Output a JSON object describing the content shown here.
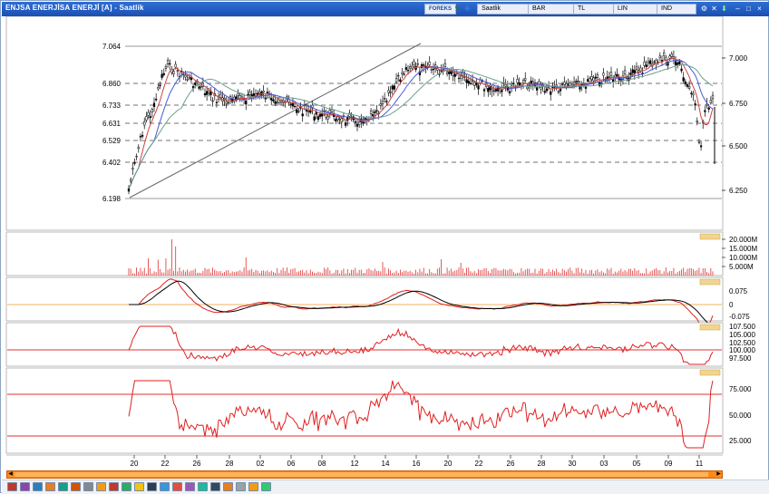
{
  "window": {
    "title": "ENJSA ENERJİSA ENERJİ [A] - Saatlik",
    "toolbar": [
      "Saatlik",
      "BAR",
      "TL",
      "LIN",
      "IND"
    ],
    "brand_badge": "FOREKS"
  },
  "price_panel": {
    "fib_levels": [
      "7.064",
      "6.860",
      "6.733",
      "6.631",
      "6.529",
      "6.402",
      "6.198"
    ],
    "axis_ticks": [
      "7.000",
      "6.750",
      "6.500",
      "6.250"
    ]
  },
  "volume_panel": {
    "axis_ticks": [
      "20.000M",
      "15.000M",
      "10.000M",
      "5.000M"
    ]
  },
  "macd_panel": {
    "axis_ticks": [
      "0.075",
      "0",
      "-0.075"
    ]
  },
  "momentum_panel": {
    "axis_ticks": [
      "107.500",
      "105.000",
      "102.500",
      "100.000",
      "97.500"
    ]
  },
  "rsi_panel": {
    "axis_ticks": [
      "75.000",
      "50.000",
      "25.000"
    ]
  },
  "x_axis": {
    "labels": [
      "20",
      "22",
      "26",
      "28",
      "02",
      "06",
      "08",
      "12",
      "14",
      "16",
      "20",
      "22",
      "26",
      "28",
      "30",
      "03",
      "05",
      "09",
      "11"
    ]
  },
  "colors": {
    "titlebar": "#1f5cc4",
    "scroll": "#ff8a1a",
    "signal": "#e02020",
    "ma_blue": "#4a5bd6",
    "ma_teal": "#6aa08a",
    "guide": "#e03030"
  },
  "icons": [
    "window-min-icon",
    "window-restore-icon",
    "window-close-icon",
    "settings-icon",
    "pencil-icon",
    "cursor-icon"
  ]
}
